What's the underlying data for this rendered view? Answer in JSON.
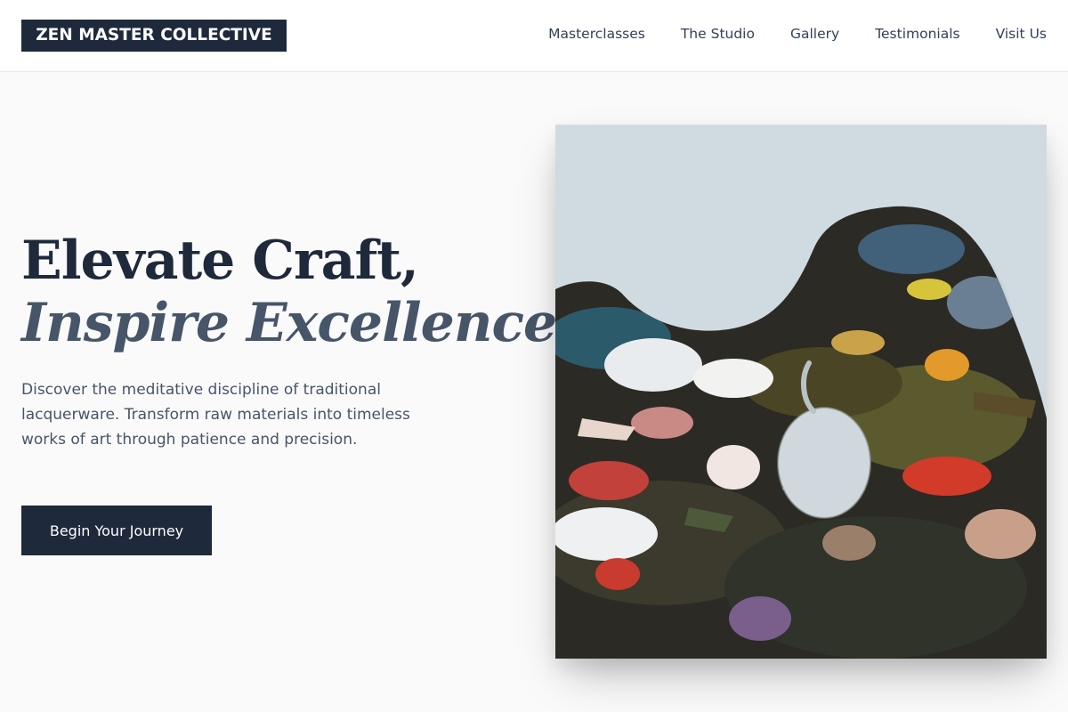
{
  "header": {
    "brand": "ZEN MASTER COLLECTIVE",
    "nav": [
      {
        "label": "Masterclasses"
      },
      {
        "label": "The Studio"
      },
      {
        "label": "Gallery"
      },
      {
        "label": "Testimonials"
      },
      {
        "label": "Visit Us"
      }
    ]
  },
  "hero": {
    "headline_line1": "Elevate Craft,",
    "headline_line2": "Inspire Excellence.",
    "description": "Discover the meditative discipline of traditional lacquerware. Transform raw materials into timeless works of art through patience and precision.",
    "cta_label": "Begin Your Journey",
    "image": {
      "subject": "paint-palette-photo",
      "colors": {
        "wall": "#c9d6dc",
        "primary": "#1e293b"
      }
    }
  }
}
